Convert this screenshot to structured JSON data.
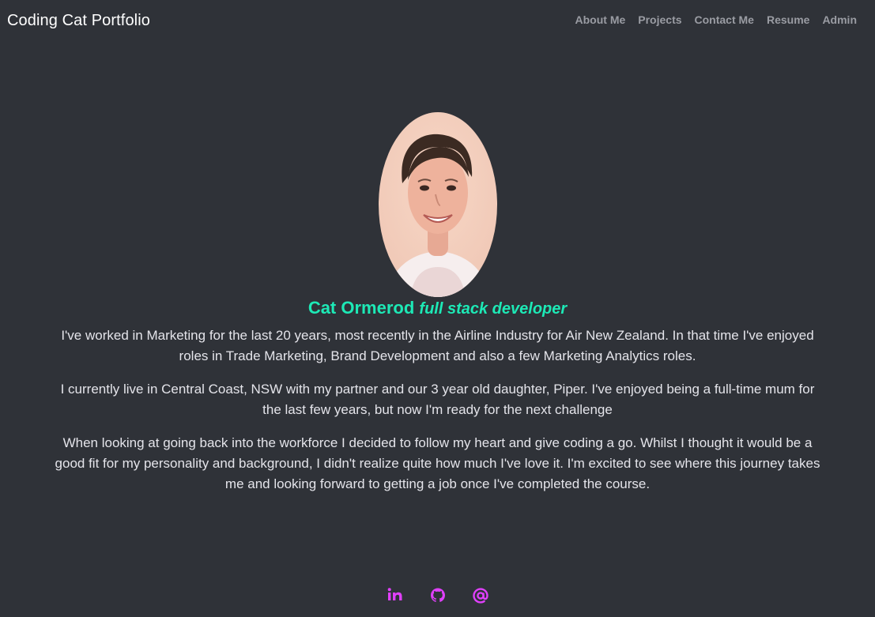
{
  "navbar": {
    "brand": "Coding Cat Portfolio",
    "links": [
      "About Me",
      "Projects",
      "Contact Me",
      "Resume",
      "Admin"
    ]
  },
  "profile": {
    "photo_icon": "profile-photo",
    "name": "Cat Ormerod",
    "role": "full stack developer"
  },
  "bio": {
    "paragraphs": [
      "I've worked in Marketing for the last 20 years, most recently in the Airline Industry for Air New Zealand. In that time I've enjoyed roles in Trade Marketing, Brand Development and also a few Marketing Analytics roles.",
      "I currently live in Central Coast, NSW with my partner and our 3 year old daughter, Piper. I've enjoyed being a full-time mum for the last few years, but now I'm ready for the next challenge",
      "When looking at going back into the workforce I decided to follow my heart and give coding a go. Whilst I thought it would be a good fit for my personality and background, I didn't realize quite how much I've love it. I'm excited to see where this journey takes me and looking forward to getting a job once I've completed the course."
    ]
  },
  "social": {
    "icons": [
      "linkedin-icon",
      "github-icon",
      "email-icon"
    ],
    "color": "#e040fb"
  },
  "colors": {
    "background": "#2f3238",
    "accent": "#1de9b6",
    "nav_link": "#9a9ca3"
  }
}
